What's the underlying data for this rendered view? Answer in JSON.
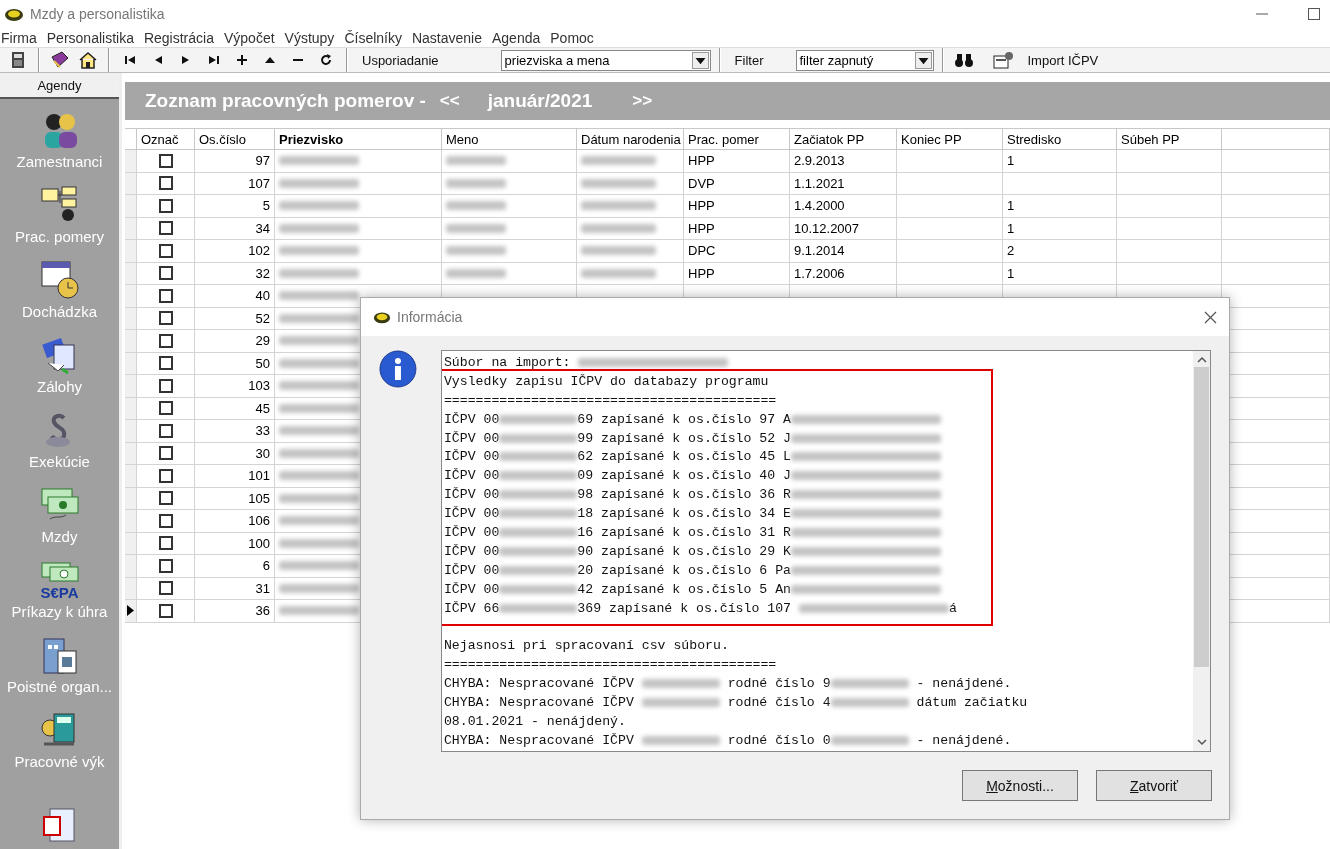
{
  "window": {
    "title": "Mzdy a personalistika"
  },
  "menu": [
    "Firma",
    "Personalistika",
    "Registrácia",
    "Výpočet",
    "Výstupy",
    "Číselníky",
    "Nastavenie",
    "Agenda",
    "Pomoc"
  ],
  "toolbar": {
    "sort_label": "Usporiadanie",
    "sort_value": "priezviska a mena",
    "filter_label": "Filter",
    "filter_value": "filter zapnutý",
    "import_button": "Import IČPV"
  },
  "sidebar": {
    "title": "Agendy",
    "items": [
      {
        "kind": "people",
        "label": "Zamestnanci"
      },
      {
        "kind": "chart",
        "label": "Prac. pomery"
      },
      {
        "kind": "clock",
        "label": "Dochádzka"
      },
      {
        "kind": "cards",
        "label": "Zálohy"
      },
      {
        "kind": "paragraph",
        "label": "Exekúcie"
      },
      {
        "kind": "money",
        "label": "Mzdy"
      },
      {
        "kind": "sepa",
        "label": "Príkazy k úhra",
        "badge": "S€PA"
      },
      {
        "kind": "building",
        "label": "Poistné organ..."
      },
      {
        "kind": "calc",
        "label": "Pracovné výk"
      },
      {
        "kind": "report"
      }
    ]
  },
  "header": {
    "title": "Zoznam pracovných pomerov -",
    "prev": "<<",
    "period": "január/2021",
    "next": ">>"
  },
  "table": {
    "columns": [
      {
        "label": "Označ",
        "bold": false
      },
      {
        "label": "Os.číslo",
        "bold": false
      },
      {
        "label": "Priezvisko",
        "bold": true
      },
      {
        "label": "Meno",
        "bold": false
      },
      {
        "label": "Dátum narodenia",
        "bold": false
      },
      {
        "label": "Prac. pomer",
        "bold": false
      },
      {
        "label": "Začiatok PP",
        "bold": false
      },
      {
        "label": "Koniec PP",
        "bold": false
      },
      {
        "label": "Stredisko",
        "bold": false
      },
      {
        "label": "Súbeh PP",
        "bold": false
      }
    ],
    "rows": [
      {
        "selected": false,
        "checked": false,
        "number": "97",
        "blurred": true,
        "contract": "HPP",
        "start": "2.9.2013",
        "center": "1"
      },
      {
        "selected": false,
        "checked": false,
        "number": "107",
        "blurred": true,
        "contract": "DVP",
        "start": "1.1.2021"
      },
      {
        "selected": false,
        "checked": false,
        "number": "5",
        "blurred": true,
        "contract": "HPP",
        "start": "1.4.2000",
        "center": "1"
      },
      {
        "selected": false,
        "checked": false,
        "number": "34",
        "blurred": true,
        "contract": "HPP",
        "start": "10.12.2007",
        "center": "1"
      },
      {
        "selected": false,
        "checked": false,
        "number": "102",
        "blurred": true,
        "contract": "DPC",
        "start": "9.1.2014",
        "center": "2"
      },
      {
        "selected": false,
        "checked": false,
        "number": "32",
        "blurred": true,
        "contract": "HPP",
        "start": "1.7.2006",
        "center": "1"
      },
      {
        "selected": false,
        "checked": false,
        "number": "40",
        "blurred": true
      },
      {
        "selected": false,
        "checked": false,
        "number": "52",
        "blurred": true
      },
      {
        "selected": false,
        "checked": false,
        "number": "29",
        "blurred": true
      },
      {
        "selected": false,
        "checked": false,
        "number": "50",
        "blurred": true
      },
      {
        "selected": false,
        "checked": false,
        "number": "103",
        "blurred": true
      },
      {
        "selected": false,
        "checked": false,
        "number": "45",
        "blurred": true
      },
      {
        "selected": false,
        "checked": false,
        "number": "33",
        "blurred": true
      },
      {
        "selected": false,
        "checked": false,
        "number": "30",
        "blurred": true
      },
      {
        "selected": false,
        "checked": false,
        "number": "101",
        "blurred": true
      },
      {
        "selected": false,
        "checked": false,
        "number": "105",
        "blurred": true
      },
      {
        "selected": false,
        "checked": false,
        "number": "106",
        "blurred": true
      },
      {
        "selected": false,
        "checked": false,
        "number": "100",
        "blurred": true
      },
      {
        "selected": false,
        "checked": false,
        "number": "6",
        "blurred": true
      },
      {
        "selected": false,
        "checked": false,
        "number": "31",
        "blurred": true
      },
      {
        "selected": true,
        "checked": false,
        "number": "36",
        "blurred": true
      }
    ]
  },
  "dialog": {
    "title": "Informácia",
    "file_line": [
      {
        "kind": "text",
        "text": "Súbor na import: "
      },
      {
        "kind": "blur"
      }
    ],
    "results": [
      [
        {
          "kind": "text",
          "text": "Vysledky zapisu IČPV do databazy programu"
        }
      ],
      [
        {
          "kind": "text",
          "text": "=========================================="
        }
      ],
      [
        {
          "kind": "text",
          "text": "IČPV 00"
        },
        {
          "kind": "blur"
        },
        {
          "kind": "text",
          "text": "69 zapísané k os.číslo 97 A"
        },
        {
          "kind": "blur"
        }
      ],
      [
        {
          "kind": "text",
          "text": "IČPV 00"
        },
        {
          "kind": "blur"
        },
        {
          "kind": "text",
          "text": "99 zapísané k os.číslo 52 J"
        },
        {
          "kind": "blur"
        }
      ],
      [
        {
          "kind": "text",
          "text": "IČPV 00"
        },
        {
          "kind": "blur"
        },
        {
          "kind": "text",
          "text": "62 zapísané k os.číslo 45 L"
        },
        {
          "kind": "blur"
        }
      ],
      [
        {
          "kind": "text",
          "text": "IČPV 00"
        },
        {
          "kind": "blur"
        },
        {
          "kind": "text",
          "text": "09 zapísané k os.číslo 40 J"
        },
        {
          "kind": "blur"
        }
      ],
      [
        {
          "kind": "text",
          "text": "IČPV 00"
        },
        {
          "kind": "blur"
        },
        {
          "kind": "text",
          "text": "98 zapísané k os.číslo 36 R"
        },
        {
          "kind": "blur"
        }
      ],
      [
        {
          "kind": "text",
          "text": "IČPV 00"
        },
        {
          "kind": "blur"
        },
        {
          "kind": "text",
          "text": "18 zapísané k os.číslo 34 E"
        },
        {
          "kind": "blur"
        }
      ],
      [
        {
          "kind": "text",
          "text": "IČPV 00"
        },
        {
          "kind": "blur"
        },
        {
          "kind": "text",
          "text": "16 zapísané k os.číslo 31 R"
        },
        {
          "kind": "blur"
        }
      ],
      [
        {
          "kind": "text",
          "text": "IČPV 00"
        },
        {
          "kind": "blur"
        },
        {
          "kind": "text",
          "text": "90 zapísané k os.číslo 29 K"
        },
        {
          "kind": "blur"
        }
      ],
      [
        {
          "kind": "text",
          "text": "IČPV 00"
        },
        {
          "kind": "blur"
        },
        {
          "kind": "text",
          "text": "20 zapísané k os.číslo 6 Pa"
        },
        {
          "kind": "blur"
        }
      ],
      [
        {
          "kind": "text",
          "text": "IČPV 00"
        },
        {
          "kind": "blur"
        },
        {
          "kind": "text",
          "text": "42 zapísané k os.číslo 5 An"
        },
        {
          "kind": "blur"
        }
      ],
      [
        {
          "kind": "text",
          "text": "IČPV 66"
        },
        {
          "kind": "blur"
        },
        {
          "kind": "text",
          "text": "369 zapísané k os.číslo 107 "
        },
        {
          "kind": "blur"
        },
        {
          "kind": "text",
          "text": "á"
        }
      ]
    ],
    "issues": [
      [
        {
          "kind": "text",
          "text": "Nejasnosi pri spracovaní csv súboru."
        }
      ],
      [
        {
          "kind": "text",
          "text": "=========================================="
        }
      ],
      [
        {
          "kind": "text",
          "text": "CHYBA: Nespracované IČPV "
        },
        {
          "kind": "blur"
        },
        {
          "kind": "text",
          "text": " rodné číslo 9"
        },
        {
          "kind": "blur"
        },
        {
          "kind": "text",
          "text": " - nenájdené."
        }
      ],
      [
        {
          "kind": "text",
          "text": "CHYBA: Nespracované IČPV "
        },
        {
          "kind": "blur"
        },
        {
          "kind": "text",
          "text": " rodné číslo 4"
        },
        {
          "kind": "blur"
        },
        {
          "kind": "text",
          "text": " dátum začiatku"
        }
      ],
      [
        {
          "kind": "text",
          "text": "08.01.2021 - nenájdený."
        }
      ],
      [
        {
          "kind": "text",
          "text": "CHYBA: Nespracované IČPV "
        },
        {
          "kind": "blur"
        },
        {
          "kind": "text",
          "text": " rodné číslo 0"
        },
        {
          "kind": "blur"
        },
        {
          "kind": "text",
          "text": " - nenájdené."
        }
      ]
    ],
    "buttons": [
      {
        "mnemonic": "M",
        "rest": "ožnosti..."
      },
      {
        "mnemonic": "Z",
        "rest": "atvoriť"
      }
    ]
  }
}
